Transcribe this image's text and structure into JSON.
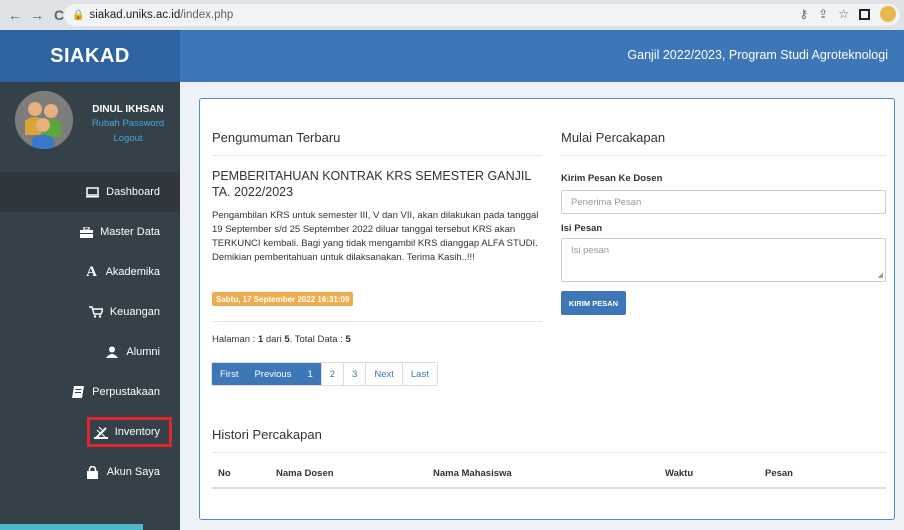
{
  "browser": {
    "url_host": "siakad.uniks.ac.id",
    "url_path": "/index.php"
  },
  "header": {
    "brand": "SIAKAD",
    "info": "Ganjil 2022/2023, Program Studi Agroteknologi"
  },
  "sidebar": {
    "user_name": "DINUL IKHSAN",
    "change_password": "Rubah Password",
    "logout": "Logout",
    "items": [
      {
        "label": "Dashboard",
        "icon": "monitor-icon"
      },
      {
        "label": "Master Data",
        "icon": "briefcase-icon"
      },
      {
        "label": "Akademika",
        "icon": "font-a-icon"
      },
      {
        "label": "Keuangan",
        "icon": "cart-icon"
      },
      {
        "label": "Alumni",
        "icon": "user-icon"
      },
      {
        "label": "Perpustakaan",
        "icon": "book-icon"
      },
      {
        "label": "Inventory",
        "icon": "inventory-icon"
      },
      {
        "label": "Akun Saya",
        "icon": "lock-icon"
      }
    ]
  },
  "announcements": {
    "title": "Pengumuman Terbaru",
    "headline": "PEMBERITAHUAN KONTRAK KRS SEMESTER GANJIL TA. 2022/2023",
    "body": "Pengambilan KRS untuk semester III, V dan VII, akan dilakukan pada tanggal 19 September s/d 25 September 2022 diluar tanggal tersebut KRS akan TERKUNCI kembali. Bagi yang tidak mengambil KRS dianggap ALFA STUDI. Demikian pemberitahuan untuk dilaksanakan. Terima Kasih..!!!",
    "date": "Sabtu, 17 September 2022 16:31:09",
    "page_label": "Halaman : ",
    "page_current": "1",
    "page_of": " dari ",
    "page_total": "5",
    "data_label": ". Total Data : ",
    "data_total": "5",
    "pager": [
      "First",
      "Previous",
      "1",
      "2",
      "3",
      "Next",
      "Last"
    ]
  },
  "history": {
    "title": "Histori Percakapan",
    "columns": [
      "No",
      "Nama Dosen",
      "Nama Mahasiswa",
      "Waktu",
      "Pesan"
    ]
  },
  "chat": {
    "title": "Mulai Percakapan",
    "to_label": "Kirim Pesan Ke Dosen",
    "to_placeholder": "Penerima Pesan",
    "msg_label": "Isi Pesan",
    "msg_placeholder": "Isi pesan",
    "send_label": "KIRIM PESAN"
  },
  "colors": {
    "header": "#3d77b7",
    "sidebar": "#354148",
    "badge": "#f0ad4e",
    "highlight": "#e0262a"
  }
}
